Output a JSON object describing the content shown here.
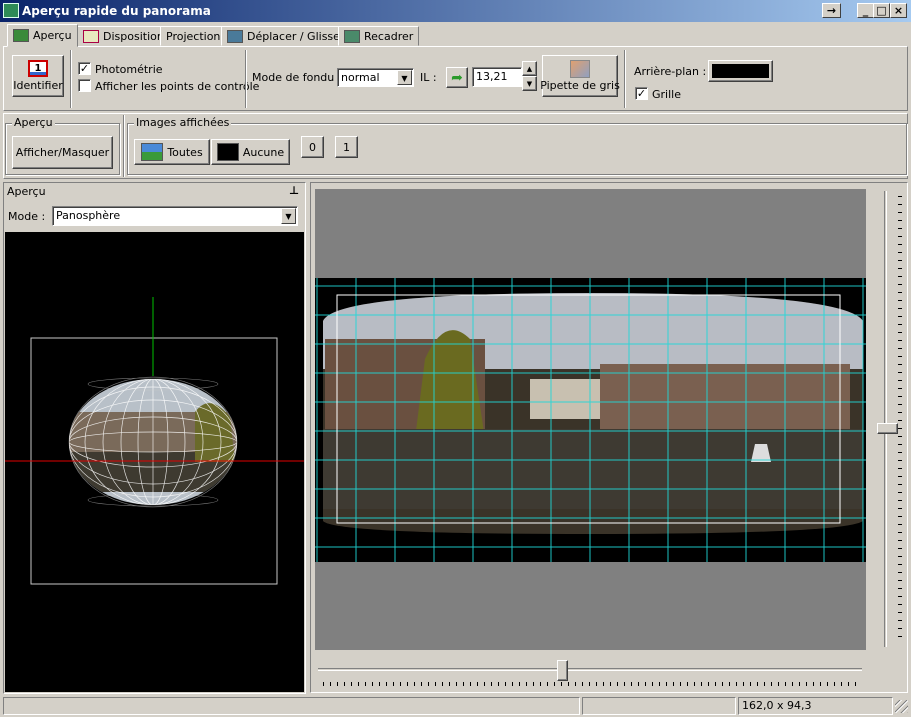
{
  "window": {
    "title": "Aperçu rapide du panorama",
    "controls": [
      "→",
      "_",
      "□",
      "×"
    ]
  },
  "tabs": [
    {
      "label": "Aperçu",
      "icon": "gl-preview-icon",
      "active": true
    },
    {
      "label": "Disposition",
      "icon": "layout-icon",
      "active": false
    },
    {
      "label": "Projection",
      "icon": "",
      "active": false
    },
    {
      "label": "Déplacer / Glisser",
      "icon": "move-drag-icon",
      "active": false
    },
    {
      "label": "Recadrer",
      "icon": "crop-icon",
      "active": false
    }
  ],
  "toolbar": {
    "identify_label": "Identifier",
    "identify_icon_text": "1",
    "photometry_label": "Photométrie",
    "photometry_checked": true,
    "show_cp_label": "Afficher les points de contrôle",
    "show_cp_checked": false,
    "blend_mode_label": "Mode de fondu :",
    "blend_mode_value": "normal",
    "ev_label": "IL :",
    "ev_value": "13,21",
    "gray_picker_label": "Pipette de gris",
    "background_label": "Arrière-plan :",
    "background_color": "#000000",
    "grid_label": "Grille",
    "grid_checked": true
  },
  "row2": {
    "apercu_group": "Aperçu",
    "show_hide_label": "Afficher/Masquer",
    "images_group": "Images affichées",
    "all_label": "Toutes",
    "none_label": "Aucune",
    "image_buttons": [
      "0",
      "1"
    ]
  },
  "left_panel": {
    "title": "Aperçu",
    "pin_icon": "pin-icon",
    "mode_label": "Mode :",
    "mode_value": "Panosphère"
  },
  "statusbar": {
    "cells": [
      "",
      "",
      "",
      "162,0 x 94,3"
    ]
  },
  "colors": {
    "grid": "#20d8d8",
    "axis_x": "#e00000",
    "axis_y": "#00c000",
    "titlebar_start": "#0a246a",
    "titlebar_end": "#a6caf0"
  }
}
